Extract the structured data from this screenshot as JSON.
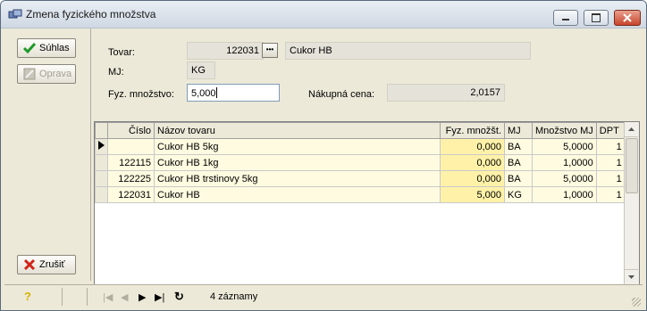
{
  "window": {
    "title": "Zmena fyzického množstva"
  },
  "buttons": {
    "suhlas": "Súhlas",
    "oprava": "Oprava",
    "zrusit": "Zrušiť"
  },
  "form": {
    "tovar_label": "Tovar:",
    "tovar_code": "122031",
    "tovar_name": "Cukor HB",
    "mj_label": "MJ:",
    "mj_value": "KG",
    "fyz_label": "Fyz. množstvo:",
    "fyz_value": "5,000",
    "cena_label": "Nákupná cena:",
    "cena_value": "2,0157",
    "lookup_glyph": "•••"
  },
  "grid": {
    "columns": [
      "Číslo",
      "Názov tovaru",
      "Fyz. množšt.",
      "MJ",
      "Množstvo MJ",
      "DPT"
    ],
    "rows": [
      {
        "cislo": "",
        "nazov": "Cukor HB 5kg",
        "fyz": "0,000",
        "mj": "BA",
        "mnozstvo": "5,0000",
        "dpt": "1",
        "current": true
      },
      {
        "cislo": "122115",
        "nazov": "Cukor HB 1kg",
        "fyz": "0,000",
        "mj": "BA",
        "mnozstvo": "1,0000",
        "dpt": "1",
        "current": false
      },
      {
        "cislo": "122225",
        "nazov": "Cukor HB trstinovy 5kg",
        "fyz": "0,000",
        "mj": "BA",
        "mnozstvo": "5,0000",
        "dpt": "1",
        "current": false
      },
      {
        "cislo": "122031",
        "nazov": "Cukor HB",
        "fyz": "5,000",
        "mj": "KG",
        "mnozstvo": "1,0000",
        "dpt": "1",
        "current": false
      }
    ]
  },
  "status": {
    "records": "4 záznamy",
    "help_glyph": "?",
    "nav_first": "|◀",
    "nav_prev": "◀",
    "nav_next": "▶",
    "nav_last": "▶|",
    "nav_refresh": "↻"
  },
  "colors": {
    "window_bg": "#ece9d8",
    "row_bg": "#fffbe0",
    "fyz_col_bg": "#fff2a8"
  }
}
